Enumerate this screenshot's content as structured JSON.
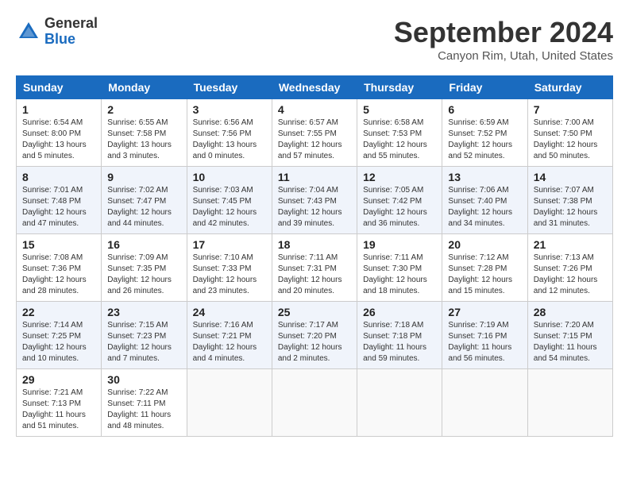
{
  "header": {
    "logo_general": "General",
    "logo_blue": "Blue",
    "month_title": "September 2024",
    "location": "Canyon Rim, Utah, United States"
  },
  "weekdays": [
    "Sunday",
    "Monday",
    "Tuesday",
    "Wednesday",
    "Thursday",
    "Friday",
    "Saturday"
  ],
  "weeks": [
    [
      {
        "day": "1",
        "sunrise": "6:54 AM",
        "sunset": "8:00 PM",
        "daylight": "13 hours and 5 minutes."
      },
      {
        "day": "2",
        "sunrise": "6:55 AM",
        "sunset": "7:58 PM",
        "daylight": "13 hours and 3 minutes."
      },
      {
        "day": "3",
        "sunrise": "6:56 AM",
        "sunset": "7:56 PM",
        "daylight": "13 hours and 0 minutes."
      },
      {
        "day": "4",
        "sunrise": "6:57 AM",
        "sunset": "7:55 PM",
        "daylight": "12 hours and 57 minutes."
      },
      {
        "day": "5",
        "sunrise": "6:58 AM",
        "sunset": "7:53 PM",
        "daylight": "12 hours and 55 minutes."
      },
      {
        "day": "6",
        "sunrise": "6:59 AM",
        "sunset": "7:52 PM",
        "daylight": "12 hours and 52 minutes."
      },
      {
        "day": "7",
        "sunrise": "7:00 AM",
        "sunset": "7:50 PM",
        "daylight": "12 hours and 50 minutes."
      }
    ],
    [
      {
        "day": "8",
        "sunrise": "7:01 AM",
        "sunset": "7:48 PM",
        "daylight": "12 hours and 47 minutes."
      },
      {
        "day": "9",
        "sunrise": "7:02 AM",
        "sunset": "7:47 PM",
        "daylight": "12 hours and 44 minutes."
      },
      {
        "day": "10",
        "sunrise": "7:03 AM",
        "sunset": "7:45 PM",
        "daylight": "12 hours and 42 minutes."
      },
      {
        "day": "11",
        "sunrise": "7:04 AM",
        "sunset": "7:43 PM",
        "daylight": "12 hours and 39 minutes."
      },
      {
        "day": "12",
        "sunrise": "7:05 AM",
        "sunset": "7:42 PM",
        "daylight": "12 hours and 36 minutes."
      },
      {
        "day": "13",
        "sunrise": "7:06 AM",
        "sunset": "7:40 PM",
        "daylight": "12 hours and 34 minutes."
      },
      {
        "day": "14",
        "sunrise": "7:07 AM",
        "sunset": "7:38 PM",
        "daylight": "12 hours and 31 minutes."
      }
    ],
    [
      {
        "day": "15",
        "sunrise": "7:08 AM",
        "sunset": "7:36 PM",
        "daylight": "12 hours and 28 minutes."
      },
      {
        "day": "16",
        "sunrise": "7:09 AM",
        "sunset": "7:35 PM",
        "daylight": "12 hours and 26 minutes."
      },
      {
        "day": "17",
        "sunrise": "7:10 AM",
        "sunset": "7:33 PM",
        "daylight": "12 hours and 23 minutes."
      },
      {
        "day": "18",
        "sunrise": "7:11 AM",
        "sunset": "7:31 PM",
        "daylight": "12 hours and 20 minutes."
      },
      {
        "day": "19",
        "sunrise": "7:11 AM",
        "sunset": "7:30 PM",
        "daylight": "12 hours and 18 minutes."
      },
      {
        "day": "20",
        "sunrise": "7:12 AM",
        "sunset": "7:28 PM",
        "daylight": "12 hours and 15 minutes."
      },
      {
        "day": "21",
        "sunrise": "7:13 AM",
        "sunset": "7:26 PM",
        "daylight": "12 hours and 12 minutes."
      }
    ],
    [
      {
        "day": "22",
        "sunrise": "7:14 AM",
        "sunset": "7:25 PM",
        "daylight": "12 hours and 10 minutes."
      },
      {
        "day": "23",
        "sunrise": "7:15 AM",
        "sunset": "7:23 PM",
        "daylight": "12 hours and 7 minutes."
      },
      {
        "day": "24",
        "sunrise": "7:16 AM",
        "sunset": "7:21 PM",
        "daylight": "12 hours and 4 minutes."
      },
      {
        "day": "25",
        "sunrise": "7:17 AM",
        "sunset": "7:20 PM",
        "daylight": "12 hours and 2 minutes."
      },
      {
        "day": "26",
        "sunrise": "7:18 AM",
        "sunset": "7:18 PM",
        "daylight": "11 hours and 59 minutes."
      },
      {
        "day": "27",
        "sunrise": "7:19 AM",
        "sunset": "7:16 PM",
        "daylight": "11 hours and 56 minutes."
      },
      {
        "day": "28",
        "sunrise": "7:20 AM",
        "sunset": "7:15 PM",
        "daylight": "11 hours and 54 minutes."
      }
    ],
    [
      {
        "day": "29",
        "sunrise": "7:21 AM",
        "sunset": "7:13 PM",
        "daylight": "11 hours and 51 minutes."
      },
      {
        "day": "30",
        "sunrise": "7:22 AM",
        "sunset": "7:11 PM",
        "daylight": "11 hours and 48 minutes."
      },
      null,
      null,
      null,
      null,
      null
    ]
  ]
}
